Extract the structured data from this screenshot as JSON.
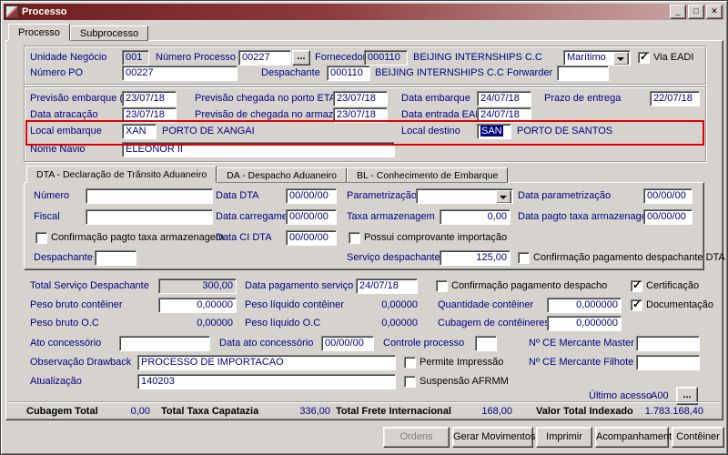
{
  "window": {
    "title": "Processo"
  },
  "titlebar": {
    "minimize_icon": "_",
    "maximize_icon": "□",
    "close_icon": "✕"
  },
  "tabs": {
    "main": [
      "Processo",
      "Subprocesso"
    ],
    "dta": [
      "DTA - Declaração de Trânsito Aduaneiro",
      "DA - Despacho Aduaneiro",
      "BL - Conhecimento de Embarque"
    ]
  },
  "top": {
    "unidade_negocio_label": "Unidade Negócio",
    "unidade_negocio": "001",
    "numero_processo_label": "Número Processo",
    "numero_processo": "00227",
    "browse_label": "...",
    "fornecedor_label": "Fornecedor",
    "fornecedor_code": "000110",
    "fornecedor_name": "BEIJING INTERNSHIPS C.C",
    "modal": "Marítimo",
    "via_eadi_label": "Via EADI",
    "via_eadi_checked": true,
    "numero_po_label": "Número PO",
    "numero_po": "00227",
    "despachante_label": "Despachante",
    "despachante_code": "000110",
    "despachante_name": "BEIJING INTERNSHIPS C.C",
    "forwarder_label": "Forwarder",
    "forwarder": ""
  },
  "dates": {
    "etd_label": "Previsão embarque (ETD)",
    "etd": "23/07/18",
    "eta_label": "Previsão chegada no porto ETA",
    "eta": "23/07/18",
    "data_embarque_label": "Data embarque",
    "data_embarque": "24/07/18",
    "prazo_entrega_label": "Prazo de entrega",
    "prazo_entrega": "22/07/18",
    "data_atracacao_label": "Data atracação",
    "data_atracacao": "23/07/18",
    "chegada_armazem_label": "Previsão de chegada no armazém",
    "chegada_armazem": "23/07/18",
    "data_entrada_eadi_label": "Data entrada EADI",
    "data_entrada_eadi": "24/07/18",
    "local_embarque_label": "Local embarque",
    "local_embarque_code": "XAN",
    "local_embarque_name": "PORTO DE XANGAI",
    "local_destino_label": "Local destino",
    "local_destino_code": "SAN",
    "local_destino_name": "PORTO DE SANTOS",
    "nome_navio_label": "Nome Navio",
    "nome_navio": "ELEONOR II"
  },
  "dta": {
    "numero_label": "Número",
    "numero": "",
    "data_dta_label": "Data DTA",
    "data_dta": "00/00/00",
    "parametrizacao_label": "Parametrização",
    "parametrizacao": "",
    "data_parametrizacao_label": "Data parametrização",
    "data_parametrizacao": "00/00/00",
    "fiscal_label": "Fiscal",
    "fiscal": "",
    "data_carregamento_label": "Data carregamento",
    "data_carregamento": "00/00/00",
    "taxa_armazenagem_label": "Taxa armazenagem",
    "taxa_armazenagem": "0,00",
    "data_pagto_taxa_label": "Data pagto taxa armazenagem",
    "data_pagto_taxa": "00/00/00",
    "conf_pagto_taxa_label": "Confirmação pagto taxa armazenagem",
    "conf_pagto_taxa_checked": false,
    "data_ci_dta_label": "Data CI DTA",
    "data_ci_dta": "00/00/00",
    "possui_comprovante_label": "Possui comprovante importação",
    "possui_comprovante_checked": false,
    "despachante_label": "Despachante",
    "despachante": "",
    "servico_despachante_label": "Serviço despachante",
    "servico_despachante": "125,00",
    "conf_pag_despachante_label": "Confirmação pagamento despachante DTA",
    "conf_pag_despachante_checked": false
  },
  "bottom": {
    "total_servico_label": "Total Serviço Despachante",
    "total_servico": "300,00",
    "data_pag_servico_label": "Data pagamento serviço",
    "data_pag_servico": "24/07/18",
    "conf_pag_despacho_label": "Confirmação pagamento despacho",
    "conf_pag_despacho_checked": false,
    "certificacao_label": "Certificação",
    "certificacao_checked": true,
    "peso_bruto_cont_label": "Peso bruto contêiner",
    "peso_bruto_cont": "0,00000",
    "peso_liq_cont_label": "Peso líquido contêiner",
    "peso_liq_cont": "0,00000",
    "qtd_cont_label": "Quantidade contêiner",
    "qtd_cont": "0,000000",
    "documentacao_label": "Documentação",
    "documentacao_checked": true,
    "peso_bruto_oc_label": "Peso bruto O.C",
    "peso_bruto_oc": "0,00000",
    "peso_liq_oc_label": "Peso líquido O.C",
    "peso_liq_oc": "0,00000",
    "cubagem_cont_label": "Cubagem de contêineres",
    "cubagem_cont": "0,000000",
    "ato_concessorio_label": "Ato concessório",
    "ato_concessorio": "",
    "data_ato_label": "Data ato concessório",
    "data_ato": "00/00/00",
    "controle_processo_label": "Controle processo",
    "controle_processo": "",
    "ce_master_label": "Nº CE Mercante Master",
    "ce_master": "",
    "obs_drawback_label": "Observação Drawback",
    "obs_drawback": "PROCESSO DE IMPORTACAO",
    "permite_impressao_label": "Permite Impressão",
    "permite_impressao_checked": false,
    "ce_filhote_label": "Nº CE Mercante Filhote",
    "ce_filhote": "",
    "atualizacao_label": "Atualização",
    "atualizacao": "140203",
    "suspensao_afrmm_label": "Suspensão AFRMM",
    "suspensao_afrmm_checked": false,
    "ultimo_acesso_label": "Último acesso",
    "ultimo_acesso": "A00",
    "browse_label": "..."
  },
  "totals": {
    "cubagem_total_label": "Cubagem Total",
    "cubagem_total": "0,00",
    "taxa_capatazia_label": "Total Taxa Capatazia",
    "taxa_capatazia": "336,00",
    "frete_label": "Total Frete Internacional",
    "frete": "168,00",
    "valor_indexado_label": "Valor Total Indexado",
    "valor_indexado": "1.783.168,40"
  },
  "footer_buttons": {
    "ordens": "Ordens",
    "gerar_movimentos": "Gerar Movimentos",
    "imprimir": "Imprimir",
    "acompanhamento": "Acompanhamento",
    "conteiner": "Contêiner"
  }
}
